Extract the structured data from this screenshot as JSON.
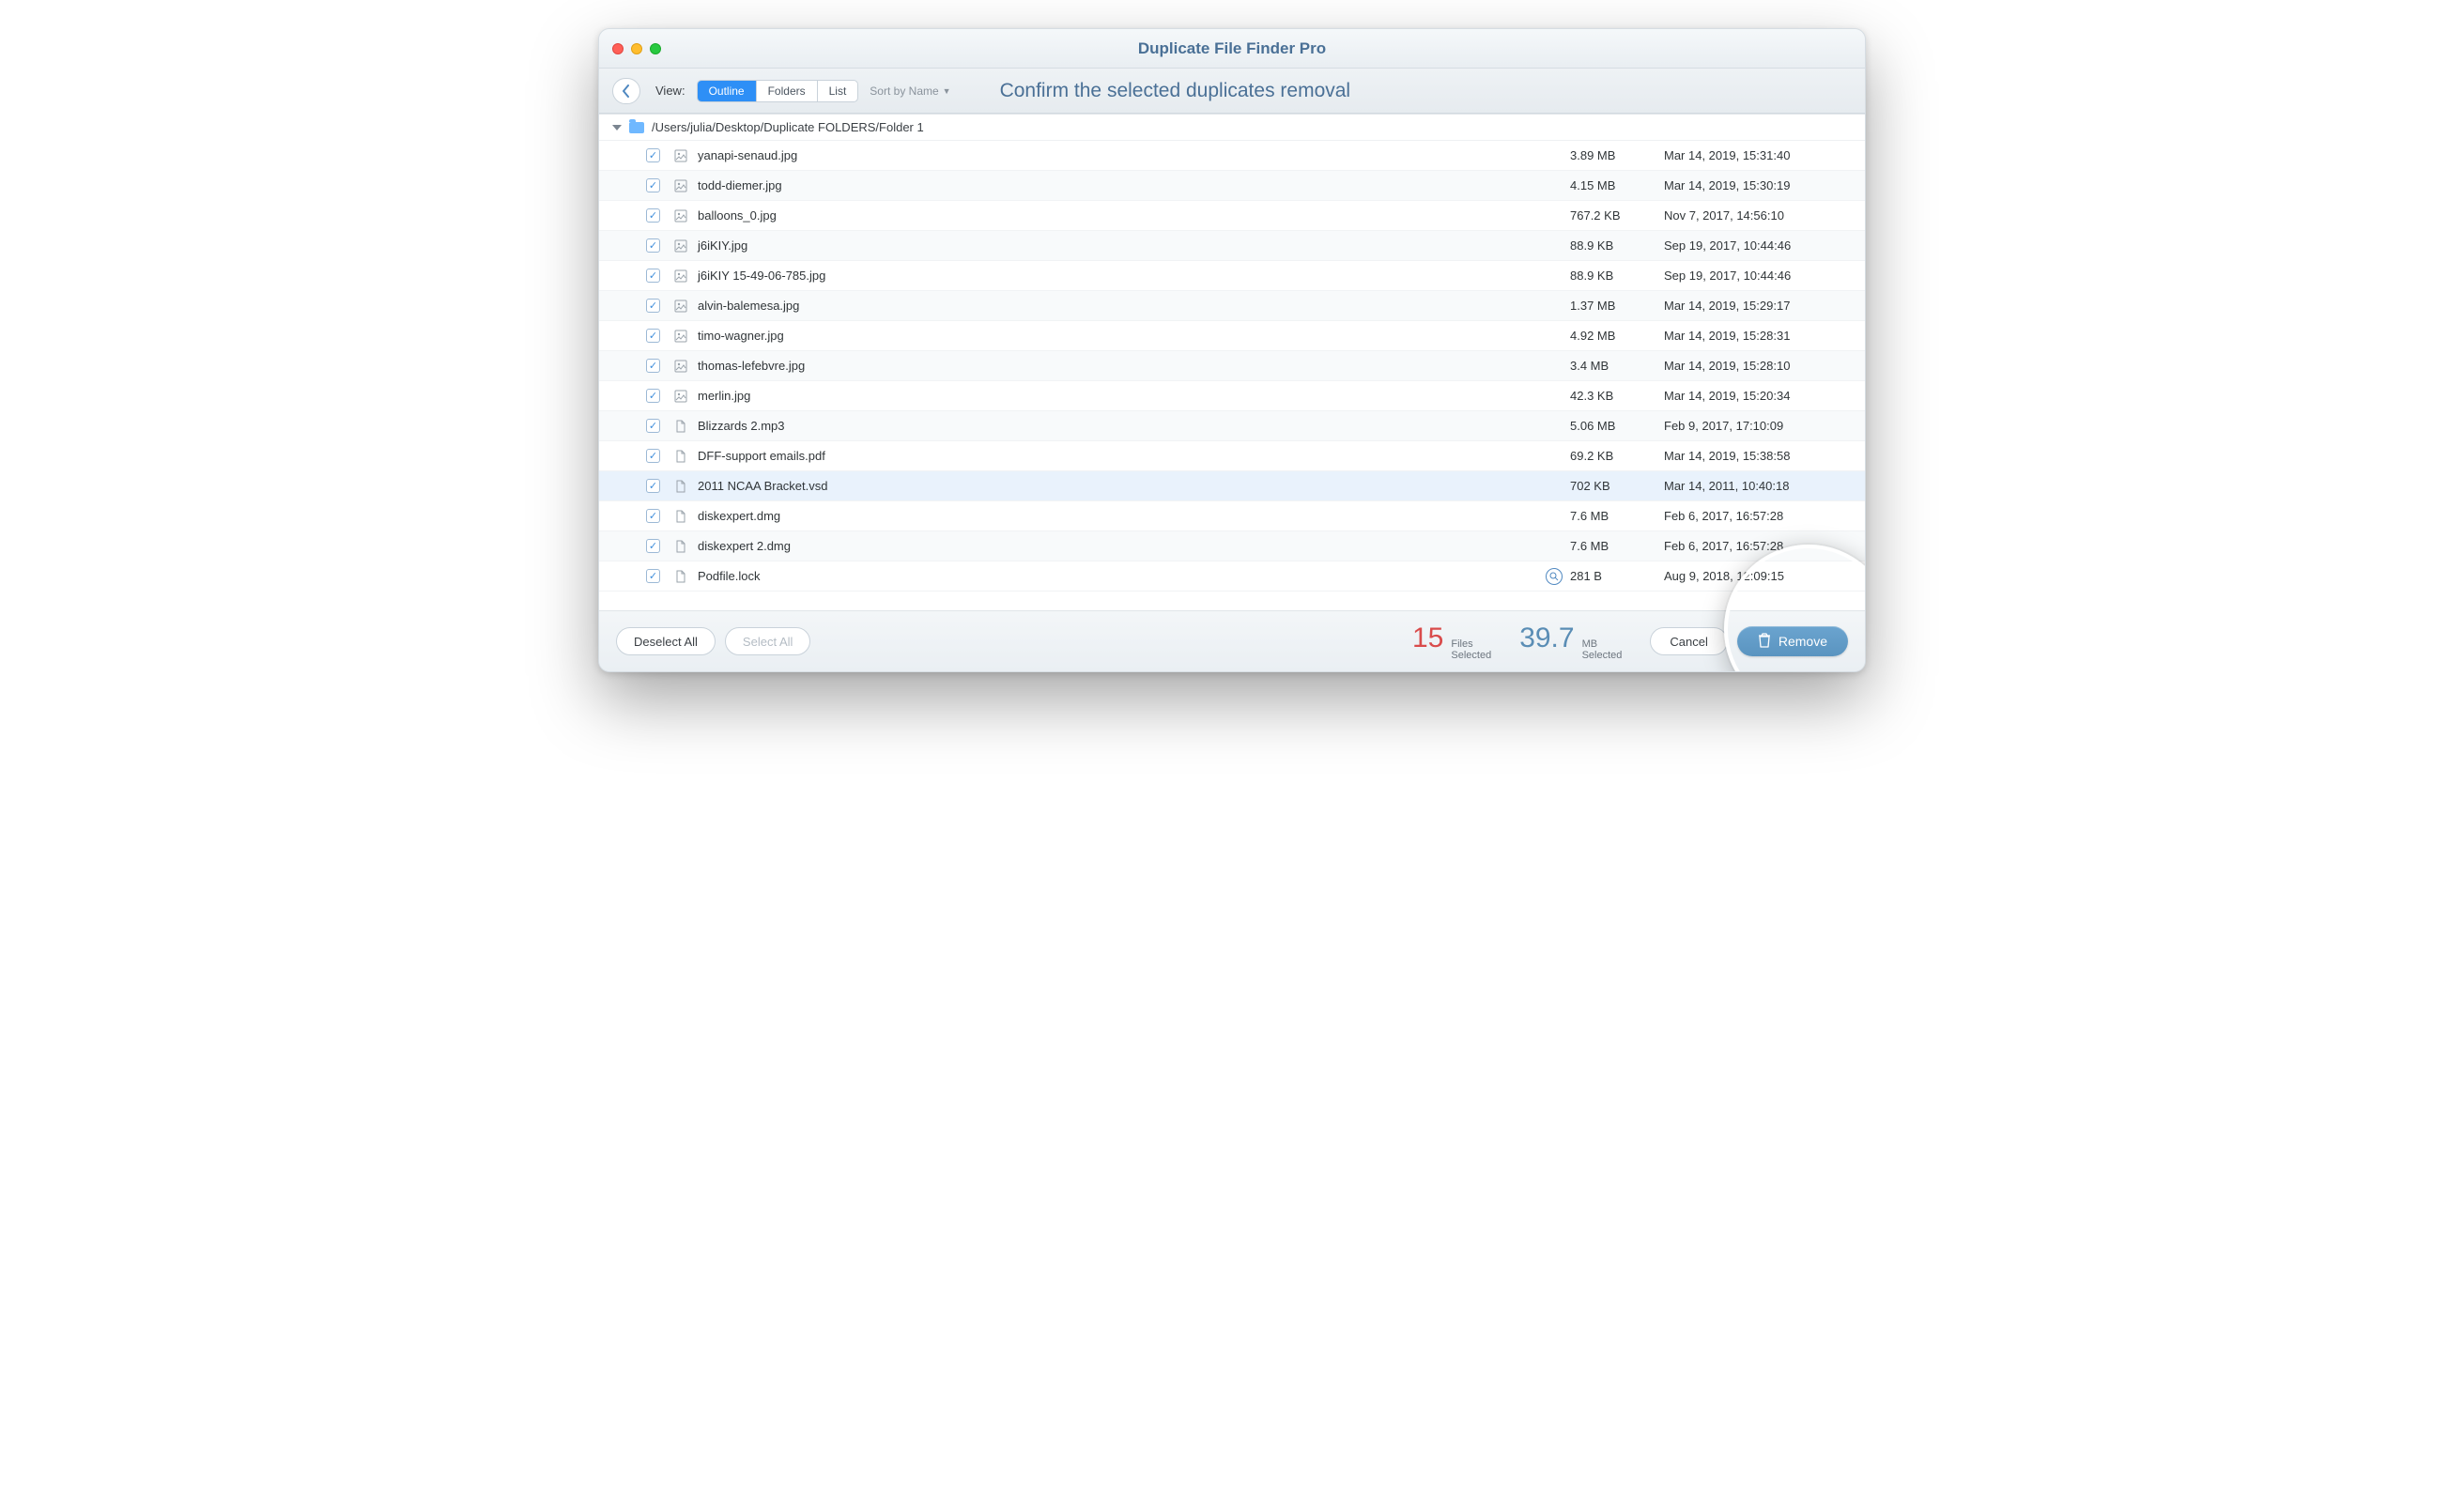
{
  "app_title": "Duplicate File Finder Pro",
  "toolbar": {
    "view_label": "View:",
    "segments": [
      "Outline",
      "Folders",
      "List"
    ],
    "active_segment": 0,
    "sort_label": "Sort by Name",
    "heading": "Confirm the selected duplicates removal"
  },
  "folder": {
    "path": "/Users/julia/Desktop/Duplicate FOLDERS/Folder 1"
  },
  "files": [
    {
      "name": "yanapi-senaud.jpg",
      "size": "3.89 MB",
      "date": "Mar 14, 2019, 15:31:40",
      "icon": "img",
      "checked": true
    },
    {
      "name": "todd-diemer.jpg",
      "size": "4.15 MB",
      "date": "Mar 14, 2019, 15:30:19",
      "icon": "img",
      "checked": true
    },
    {
      "name": "balloons_0.jpg",
      "size": "767.2 KB",
      "date": "Nov 7, 2017, 14:56:10",
      "icon": "img",
      "checked": true
    },
    {
      "name": "j6iKIY.jpg",
      "size": "88.9 KB",
      "date": "Sep 19, 2017, 10:44:46",
      "icon": "img",
      "checked": true
    },
    {
      "name": "j6iKIY 15-49-06-785.jpg",
      "size": "88.9 KB",
      "date": "Sep 19, 2017, 10:44:46",
      "icon": "img",
      "checked": true
    },
    {
      "name": "alvin-balemesa.jpg",
      "size": "1.37 MB",
      "date": "Mar 14, 2019, 15:29:17",
      "icon": "img",
      "checked": true
    },
    {
      "name": "timo-wagner.jpg",
      "size": "4.92 MB",
      "date": "Mar 14, 2019, 15:28:31",
      "icon": "img",
      "checked": true
    },
    {
      "name": "thomas-lefebvre.jpg",
      "size": "3.4 MB",
      "date": "Mar 14, 2019, 15:28:10",
      "icon": "img",
      "checked": true
    },
    {
      "name": "merlin.jpg",
      "size": "42.3 KB",
      "date": "Mar 14, 2019, 15:20:34",
      "icon": "img",
      "checked": true
    },
    {
      "name": "Blizzards 2.mp3",
      "size": "5.06 MB",
      "date": "Feb 9, 2017, 17:10:09",
      "icon": "generic",
      "checked": true
    },
    {
      "name": "DFF-support emails.pdf",
      "size": "69.2 KB",
      "date": "Mar 14, 2019, 15:38:58",
      "icon": "generic",
      "checked": true
    },
    {
      "name": "2011 NCAA Bracket.vsd",
      "size": "702 KB",
      "date": "Mar 14, 2011, 10:40:18",
      "icon": "generic",
      "checked": true,
      "selected": true
    },
    {
      "name": "diskexpert.dmg",
      "size": "7.6 MB",
      "date": "Feb 6, 2017, 16:57:28",
      "icon": "generic",
      "checked": true
    },
    {
      "name": "diskexpert 2.dmg",
      "size": "7.6 MB",
      "date": "Feb 6, 2017, 16:57:28",
      "icon": "generic",
      "checked": true
    },
    {
      "name": "Podfile.lock",
      "size": "281 B",
      "date": "Aug 9, 2018, 12:09:15",
      "icon": "generic",
      "checked": true,
      "magnify": true
    }
  ],
  "footer": {
    "deselect_label": "Deselect All",
    "select_label": "Select All",
    "files_count": "15",
    "files_label": "Files\nSelected",
    "size_value": "39.7",
    "size_label": "MB\nSelected",
    "cancel_label": "Cancel",
    "remove_label": "Remove"
  }
}
